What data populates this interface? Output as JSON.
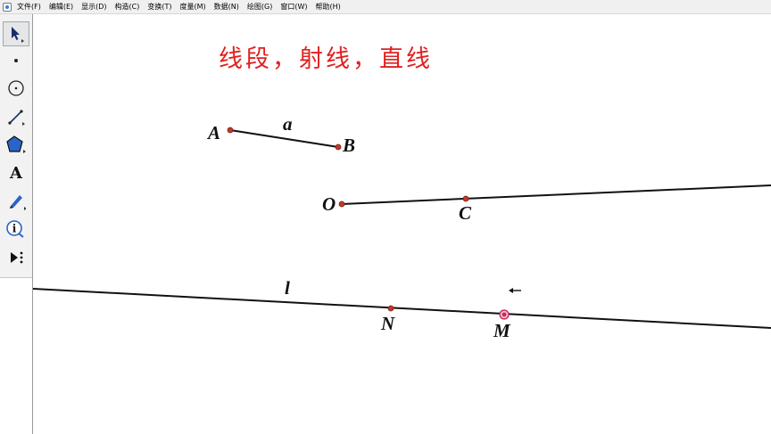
{
  "menu": {
    "items": [
      "文件(F)",
      "编辑(E)",
      "显示(D)",
      "构造(C)",
      "变换(T)",
      "度量(M)",
      "数据(N)",
      "绘图(G)",
      "窗口(W)",
      "帮助(H)"
    ]
  },
  "toolbar": {
    "tools": [
      "selection-arrow-icon",
      "point-icon",
      "compass-icon",
      "segment-icon",
      "polygon-icon",
      "text-tool-icon",
      "marker-icon",
      "info-icon",
      "custom-tools-icon"
    ],
    "text_tool_glyph": "A",
    "info_glyph": "i"
  },
  "canvas": {
    "title": "线段，射线，直线",
    "title_color": "#e02020",
    "point_color": "#c0392b",
    "labels": {
      "A": "A",
      "B": "B",
      "a": "a",
      "O": "O",
      "C": "C",
      "l": "l",
      "N": "N",
      "M": "M"
    }
  }
}
